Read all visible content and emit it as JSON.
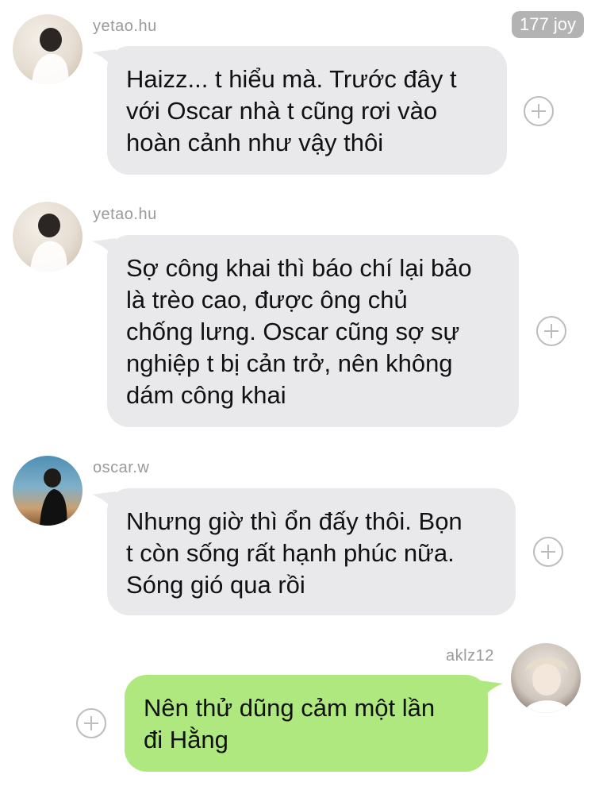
{
  "badge": "177 joy",
  "messages": [
    {
      "sender": "yetao.hu",
      "text": "Haizz... t hiểu mà. Trước đây t\nvới Oscar nhà t cũng rơi vào\nhoàn cảnh như vậy thôi"
    },
    {
      "sender": "yetao.hu",
      "text": "Sợ công khai thì báo chí lại bảo\nlà trèo cao, được ông chủ\nchống lưng. Oscar cũng sợ sự\nnghiệp t bị cản trở, nên không\ndám công khai"
    },
    {
      "sender": "oscar.w",
      "text": "Nhưng giờ thì ổn đấy thôi. Bọn\nt còn sống rất hạnh phúc nữa.\nSóng gió qua rồi"
    },
    {
      "sender": "aklz12",
      "text": "Nên thử dũng cảm một lần\nđi Hằng"
    }
  ],
  "colors": {
    "incoming_bubble": "#e9e9eb",
    "outgoing_bubble": "#aee87f",
    "username": "#9a9a9a",
    "badge": "#b3b3b3"
  },
  "icons": [
    "avatar",
    "plus-circle-icon"
  ]
}
